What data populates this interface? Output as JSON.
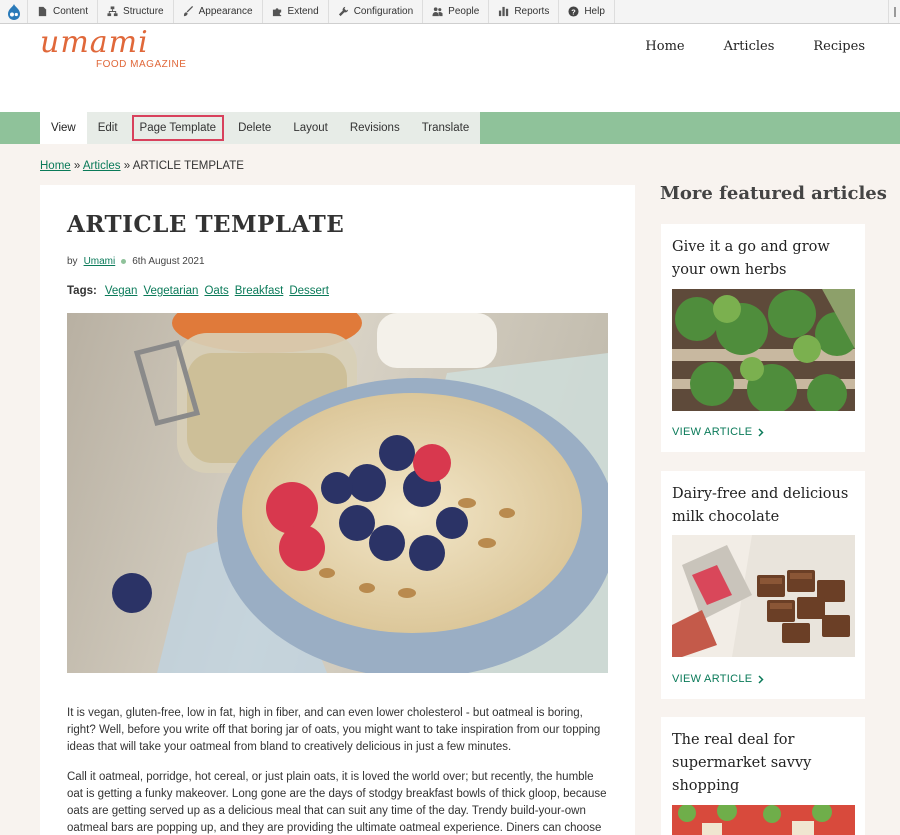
{
  "toolbar": {
    "items": [
      {
        "label": "Content",
        "icon": "file-icon"
      },
      {
        "label": "Structure",
        "icon": "sitemap-icon"
      },
      {
        "label": "Appearance",
        "icon": "brush-icon"
      },
      {
        "label": "Extend",
        "icon": "puzzle-icon"
      },
      {
        "label": "Configuration",
        "icon": "wrench-icon"
      },
      {
        "label": "People",
        "icon": "people-icon"
      },
      {
        "label": "Reports",
        "icon": "bar-chart-icon"
      },
      {
        "label": "Help",
        "icon": "help-icon"
      }
    ]
  },
  "brand": {
    "name": "umami",
    "tagline": "FOOD MAGAZINE",
    "color": "#e0683a"
  },
  "nav": {
    "home": "Home",
    "articles": "Articles",
    "recipes": "Recipes"
  },
  "tasks": {
    "view": "View",
    "edit": "Edit",
    "page_template": "Page Template",
    "delete": "Delete",
    "layout": "Layout",
    "revisions": "Revisions",
    "translate": "Translate"
  },
  "breadcrumb": {
    "home": "Home",
    "sep1": "»",
    "articles": "Articles",
    "sep2": "»",
    "current": "ARTICLE TEMPLATE"
  },
  "article": {
    "title": "ARTICLE TEMPLATE",
    "by": "by",
    "author": "Umami",
    "date": "6th August 2021",
    "tags_label": "Tags:",
    "tags": [
      "Vegan",
      "Vegetarian",
      "Oats",
      "Breakfast",
      "Dessert"
    ],
    "paragraphs": [
      "It is vegan, gluten-free, low in fat, high in fiber, and can even lower cholesterol - but oatmeal is boring, right? Well, before you write off that boring jar of oats, you might want to take inspiration from our topping ideas that will take your oatmeal from bland to creatively delicious in just a few minutes.",
      "Call it oatmeal, porridge, hot cereal, or just plain oats, it is loved the world over; but recently, the humble oat is getting a funky makeover. Long gone are the days of stodgy breakfast bowls of thick gloop, because oats are getting served up as a delicious meal that can suit any time of the day. Trendy build-your-own oatmeal bars are popping up, and they are providing the ultimate oatmeal experience. Diners can choose"
    ]
  },
  "sidebar": {
    "heading": "More featured articles",
    "cards": [
      {
        "title": "Give it a go and grow your own herbs",
        "link": "VIEW ARTICLE"
      },
      {
        "title": "Dairy-free and delicious milk chocolate",
        "link": "VIEW ARTICLE"
      },
      {
        "title": "The real deal for supermarket savvy shopping",
        "link": ""
      }
    ]
  },
  "colors": {
    "accent_green": "#8fc29a",
    "link": "#0a7a59",
    "highlight": "#d8415c"
  }
}
